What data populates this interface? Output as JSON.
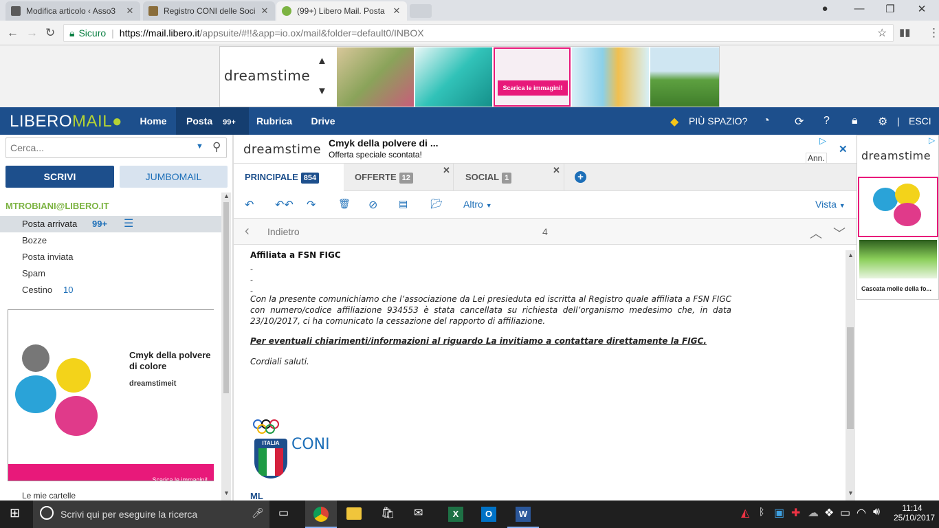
{
  "browser": {
    "tabs": [
      {
        "title": "Modifica articolo ‹ Asso3",
        "favicon_color": "#5a5a5a"
      },
      {
        "title": "Registro CONI delle Soci",
        "favicon_color": "#8a6d3b"
      },
      {
        "title": "(99+) Libero Mail. Posta",
        "favicon_color": "#7cb342"
      }
    ],
    "secure_label": "Sicuro",
    "url_host": "https://mail.libero.it",
    "url_path": "/appsuite/#!!&app=io.ox/mail&folder=default0/INBOX"
  },
  "top_ad": {
    "brand": "dreamstime",
    "cta": "Scarica le immagini!"
  },
  "header": {
    "logo_a": "LIBERO",
    "logo_b": "MAIL",
    "nav": [
      "Home",
      "Posta",
      "Rubrica",
      "Drive"
    ],
    "posta_badge": "99+",
    "more_space": "PIÙ SPAZIO?",
    "logout": "ESCI",
    "divider": "|"
  },
  "sidebar": {
    "search_placeholder": "Cerca...",
    "compose": "SCRIVI",
    "jumbomail": "JUMBOMAIL",
    "account": "MTROBIANI@LIBERO.IT",
    "folders": [
      {
        "label": "Posta arrivata",
        "count": "99+"
      },
      {
        "label": "Bozze",
        "count": ""
      },
      {
        "label": "Posta inviata",
        "count": ""
      },
      {
        "label": "Spam",
        "count": ""
      },
      {
        "label": "Cestino",
        "count": "10"
      }
    ],
    "ad_title": "Cmyk della polvere di colore",
    "ad_source": "dreamstimeit",
    "ad_cta": "Scarica le immagini!",
    "my_folders": "Le mie cartelle"
  },
  "mid_ad": {
    "brand": "dreamstime",
    "title": "Cmyk della polvere di ...",
    "subtitle": "Offerta speciale scontata!",
    "ann": "Ann."
  },
  "mail_tabs": [
    {
      "label": "PRINCIPALE",
      "count": "854"
    },
    {
      "label": "OFFERTE",
      "count": "12"
    },
    {
      "label": "SOCIAL",
      "count": "1"
    }
  ],
  "toolbar": {
    "more": "Altro",
    "view": "Vista"
  },
  "reader": {
    "back": "Indietro",
    "position": "4"
  },
  "message": {
    "heading": "Affiliata a FSN  FIGC",
    "dashes": [
      "-",
      "-",
      "-"
    ],
    "para1": "Con la presente comunichiamo che l’associazione da Lei presieduta ed iscritta al Registro quale affiliata a FSN FIGC con numero/codice affiliazione 934553    è stata cancellata su richiesta dell’organismo medesimo che, in data 23/10/2017, ci ha comunicato la cessazione del rapporto di affiliazione.",
    "para2": "Per eventuali chiarimenti/informazioni al riguardo La invitiamo a contattare direttamente la FIGC.",
    "closing": "Cordiali saluti.",
    "shield_text": "ITALIA",
    "org": "CONI",
    "signature": "ML"
  },
  "right_ad": {
    "brand": "dreamstime",
    "caption": "Cascata molle della fo..."
  },
  "taskbar": {
    "search": "Scrivi qui per eseguire la ricerca",
    "time": "11:14",
    "date": "25/10/2017"
  },
  "colors": {
    "header": "#1d4f8c",
    "accent": "#1d6fb8",
    "account": "#7cb342",
    "ad_pink": "#e8197a"
  }
}
